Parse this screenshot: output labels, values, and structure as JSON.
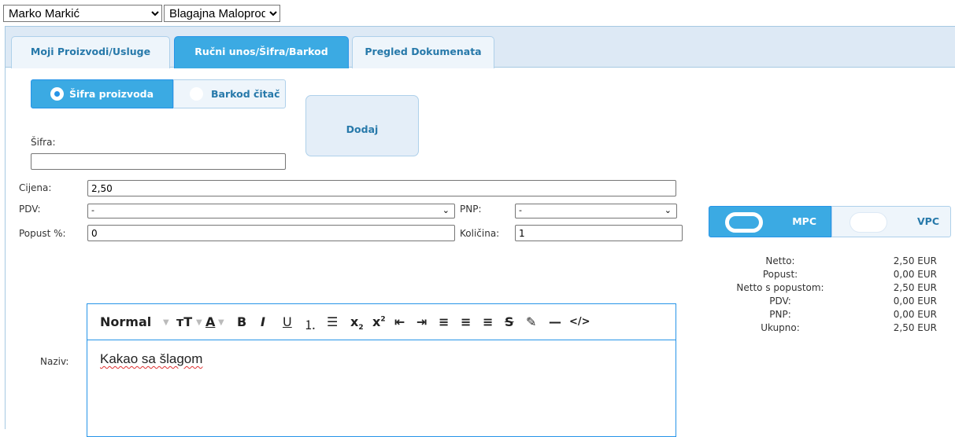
{
  "top": {
    "user_select": "Marko Markić",
    "register_select": "Blagajna Maloprodaja"
  },
  "tabs": [
    {
      "label": "Moji Proizvodi/Usluge"
    },
    {
      "label": "Ručni unos/Šifra/Barkod"
    },
    {
      "label": "Pregled Dokumenata"
    }
  ],
  "entry_mode": {
    "option1": "Šifra proizvoda",
    "option2": "Barkod čitač"
  },
  "add_button": "Dodaj",
  "form": {
    "sifra_label": "Šifra:",
    "sifra_value": "",
    "cijena_label": "Cijena:",
    "cijena_value": "2,50",
    "pdv_label": "PDV:",
    "pdv_value": "-",
    "pnp_label": "PNP:",
    "pnp_value": "-",
    "popust_label": "Popust %:",
    "popust_value": "0",
    "kolicina_label": "Količina:",
    "kolicina_value": "1",
    "naziv_label": "Naziv:"
  },
  "editor": {
    "format": "Normal",
    "content": "Kakao sa šlagom"
  },
  "price_mode": {
    "mpc": "MPC",
    "vpc": "VPC"
  },
  "summary": [
    {
      "label": "Netto:",
      "value": "2,50 EUR"
    },
    {
      "label": "Popust:",
      "value": "0,00 EUR"
    },
    {
      "label": "Netto s popustom:",
      "value": "2,50 EUR"
    },
    {
      "label": "PDV:",
      "value": "0,00 EUR"
    },
    {
      "label": "PNP:",
      "value": "0,00 EUR"
    },
    {
      "label": "Ukupno:",
      "value": "2,50 EUR"
    }
  ]
}
